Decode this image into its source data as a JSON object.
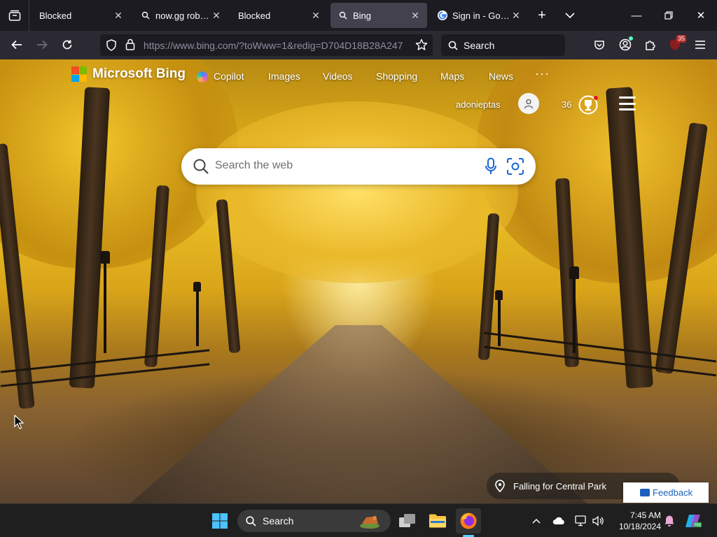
{
  "browser": {
    "tabs": [
      {
        "label": "Blocked",
        "active": false
      },
      {
        "label": "now.gg roblox - ",
        "active": false
      },
      {
        "label": "Blocked",
        "active": false
      },
      {
        "label": "Bing",
        "active": true
      },
      {
        "label": "Sign in - Google",
        "active": false
      }
    ],
    "url": "https://www.bing.com/?toWww=1&redig=D704D18B28A247",
    "search_placeholder": "Search",
    "extension_badge": "35"
  },
  "bing": {
    "brand": "Microsoft Bing",
    "nav": [
      "Copilot",
      "Images",
      "Videos",
      "Shopping",
      "Maps",
      "News"
    ],
    "more": "···",
    "user_name": "adonieptas",
    "points": "36",
    "search_placeholder": "Search the web",
    "image_caption": "Falling for Central Park",
    "feedback_label": "Feedback"
  },
  "taskbar": {
    "search_label": "Search",
    "time": "7:45 AM",
    "date": "10/18/2024"
  },
  "colors": {
    "ms_red": "#f25022",
    "ms_green": "#7fba00",
    "ms_blue": "#00a4ef",
    "ms_yellow": "#ffb900",
    "accent": "#60cdff"
  }
}
